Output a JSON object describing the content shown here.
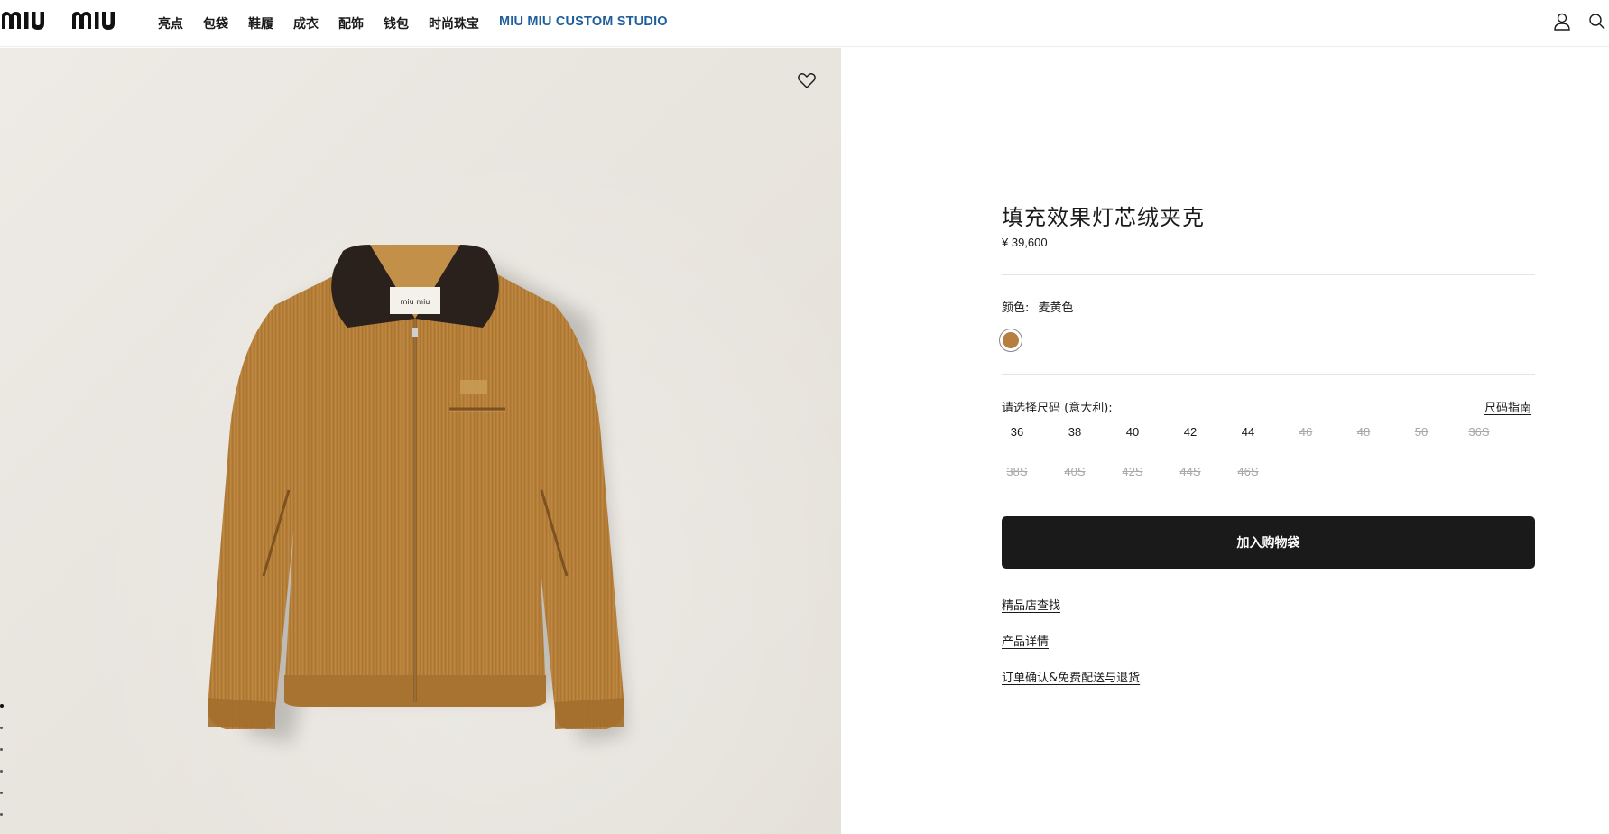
{
  "header": {
    "logo_text": "MIU MIU",
    "nav": [
      "亮点",
      "包袋",
      "鞋履",
      "成衣",
      "配饰",
      "钱包",
      "时尚珠宝",
      "MIU MIU CUSTOM STUDIO"
    ],
    "account_icon": "user-icon",
    "search_icon": "search-icon",
    "studio_color": "#1f5f9b"
  },
  "gallery": {
    "wishlist_icon": "heart-icon",
    "slide_count": 6,
    "active_slide": 1,
    "background_color": "#ebe7e1"
  },
  "product": {
    "title": "填充效果灯芯绒夹克",
    "price": "¥ 39,600",
    "color_label": "颜色:",
    "color_value": "麦黄色",
    "swatch_color": "#b67f3f",
    "size_label": "请选择尺码 (意大利):",
    "size_guide": "尺码指南",
    "sizes": [
      {
        "label": "36",
        "available": true
      },
      {
        "label": "38",
        "available": true
      },
      {
        "label": "40",
        "available": true
      },
      {
        "label": "42",
        "available": true
      },
      {
        "label": "44",
        "available": true
      },
      {
        "label": "46",
        "available": false
      },
      {
        "label": "48",
        "available": false
      },
      {
        "label": "50",
        "available": false
      },
      {
        "label": "36S",
        "available": false
      },
      {
        "label": "38S",
        "available": false
      },
      {
        "label": "40S",
        "available": false
      },
      {
        "label": "42S",
        "available": false
      },
      {
        "label": "44S",
        "available": false
      },
      {
        "label": "46S",
        "available": false
      }
    ],
    "add_to_bag": "加入购物袋",
    "links": [
      "精品店查找",
      "产品详情",
      "订单确认&免费配送与退货"
    ]
  }
}
